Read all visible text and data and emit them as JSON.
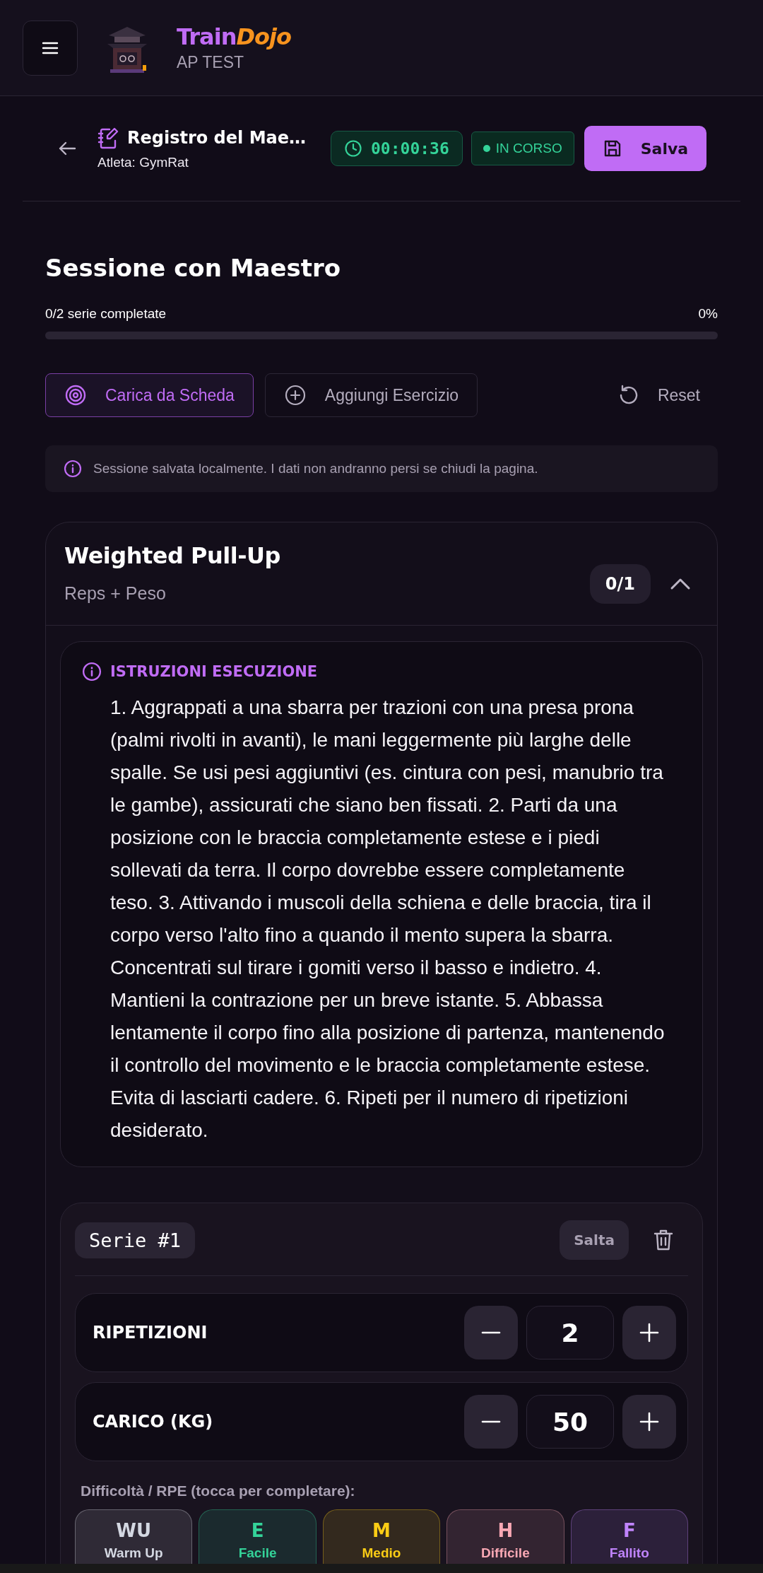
{
  "header": {
    "brand_part1": "Train",
    "brand_part2": "Dojo",
    "subtitle": "AP TEST"
  },
  "toolbar": {
    "title": "Registro del Mae…",
    "athlete": "Atleta: GymRat",
    "timer": "00:00:36",
    "status": "IN CORSO",
    "save_label": "Salva"
  },
  "session": {
    "title": "Sessione con Maestro",
    "progress_label": "0/2 serie completate",
    "progress_percent": "0%",
    "level": 0
  },
  "actions": [
    {
      "label": "Carica da Scheda",
      "kind": "primary"
    },
    {
      "label": "Aggiungi Esercizio",
      "kind": "outline"
    },
    {
      "label": "Reset",
      "kind": "ghost"
    }
  ],
  "notice": "Sessione salvata localmente. I dati non andranno persi se chiudi la pagina.",
  "exercise": {
    "name": "Weighted Pull-Up",
    "type": "Reps + Peso",
    "count": "0/1",
    "expanded": true,
    "instructions_title": "ISTRUZIONI ESECUZIONE",
    "instructions": "1. Aggrappati a una sbarra per trazioni con una presa prona (palmi rivolti in avanti), le mani leggermente più larghe delle spalle. Se usi pesi aggiuntivi (es. cintura con pesi, manubrio tra le gambe), assicurati che siano ben fissati. 2. Parti da una posizione con le braccia completamente estese e i piedi sollevati da terra. Il corpo dovrebbe essere completamente teso. 3. Attivando i muscoli della schiena e delle braccia, tira il corpo verso l'alto fino a quando il mento supera la sbarra. Concentrati sul tirare i gomiti verso il basso e indietro. 4. Mantieni la contrazione per un breve istante. 5. Abbassa lentamente il corpo fino alla posizione di partenza, mantenendo il controllo del movimento e le braccia completamente estese. Evita di lasciarti cadere. 6. Ripeti per il numero di ripetizioni desiderato.",
    "sets": [
      {
        "label": "Serie #1",
        "skip_label": "Salta",
        "fields": [
          {
            "label": "RIPETIZIONI",
            "value": "2"
          },
          {
            "label": "CARICO (KG)",
            "value": "50"
          }
        ],
        "rpe_prompt": "Difficoltà / RPE (tocca per completare):",
        "rpe": [
          {
            "code": "WU",
            "label": "Warm Up",
            "color": "#d4d8e2"
          },
          {
            "code": "E",
            "label": "Facile",
            "color": "#34d399"
          },
          {
            "code": "M",
            "label": "Medio",
            "color": "#facc15"
          },
          {
            "code": "H",
            "label": "Difficile",
            "color": "#f9a8b4"
          },
          {
            "code": "F",
            "label": "Fallito",
            "color": "#c084fc"
          }
        ]
      }
    ]
  }
}
